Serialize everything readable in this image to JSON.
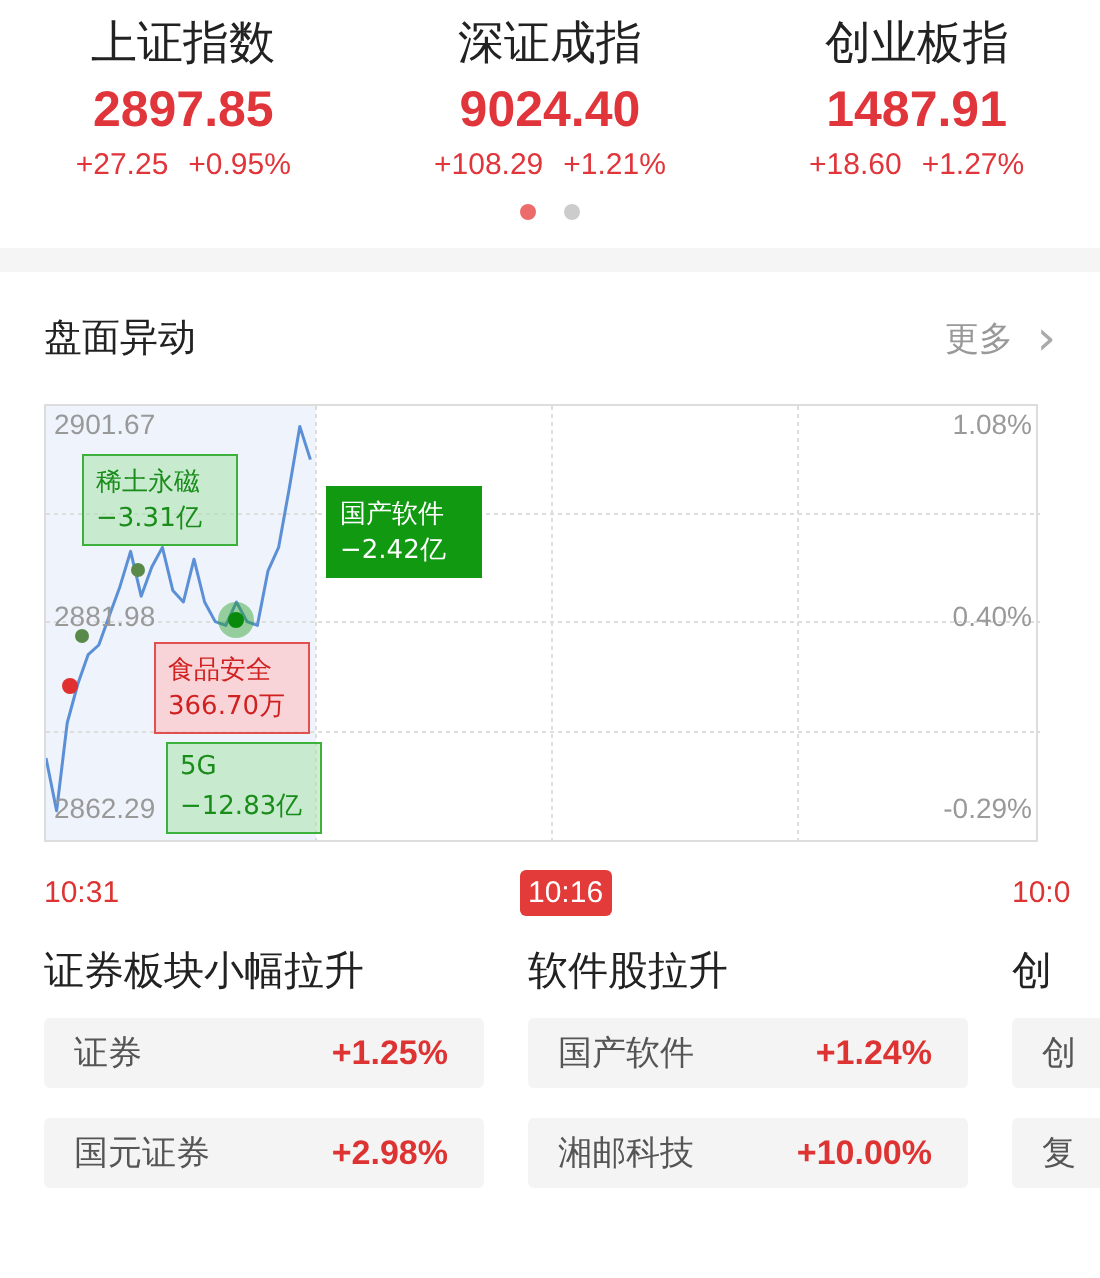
{
  "indices": [
    {
      "name": "上证指数",
      "value": "2897.85",
      "change": "+27.25",
      "percent": "+0.95%"
    },
    {
      "name": "深证成指",
      "value": "9024.40",
      "change": "+108.29",
      "percent": "+1.21%"
    },
    {
      "name": "创业板指",
      "value": "1487.91",
      "change": "+18.60",
      "percent": "+1.27%"
    }
  ],
  "pager": [
    {
      "selected": true
    },
    {
      "selected": false
    }
  ],
  "section": {
    "title": "盘面异动",
    "more": "更多",
    "more_arrow": "›"
  },
  "chart": {
    "chart_data": {
      "type": "line",
      "categories": [
        null,
        null,
        null,
        null,
        null,
        null,
        null,
        null,
        null,
        null,
        null,
        null,
        null,
        null,
        null,
        null,
        null,
        null,
        null,
        null,
        null,
        null,
        null,
        null,
        null,
        null,
        null,
        null,
        null,
        null,
        null,
        null,
        null,
        null,
        null,
        null,
        null,
        null,
        null,
        null,
        null,
        null,
        null,
        null,
        null,
        null,
        null,
        null,
        null,
        null,
        null,
        null,
        null,
        null,
        null,
        null,
        null,
        null,
        null,
        null,
        null,
        null,
        null,
        null,
        null,
        null,
        null,
        null,
        null,
        null,
        null,
        null,
        null,
        null,
        null,
        null,
        null,
        null,
        null,
        null,
        null,
        null,
        null,
        null,
        null,
        null,
        null,
        null,
        null,
        null,
        null,
        null,
        null,
        null,
        null
      ],
      "ylim": [
        2859.3,
        2903.8
      ],
      "yticks": [
        {
          "value": 2862.29,
          "label": "2862.29"
        },
        {
          "value": 2881.98,
          "label": "2881.98"
        },
        {
          "value": 2901.67,
          "label": "2901.67"
        }
      ],
      "series": [
        {
          "color": "#5b8fd6",
          "values": [
            2867.7,
            2862.3,
            2871.3,
            2875.3,
            2878.3,
            2879.3,
            2882.3,
            2885.3,
            2888.9,
            2884.3,
            2887.3,
            2889.3,
            2884.9,
            2883.7,
            2888.1,
            2883.7,
            2881.7,
            2881.3,
            2883.7,
            2881.7,
            2881.3,
            2886.9,
            2889.3,
            2895.3,
            2901.7,
            2898.3,
            null,
            null,
            null,
            null,
            null,
            null,
            null,
            null,
            null,
            null,
            null,
            null,
            null,
            null,
            null,
            null,
            null,
            null,
            null,
            null,
            null,
            null,
            null,
            null,
            null,
            null,
            null,
            null,
            null,
            null,
            null,
            null,
            null,
            null,
            null,
            null,
            null,
            null,
            null,
            null,
            null,
            null,
            null,
            null,
            null,
            null,
            null,
            null,
            null,
            null,
            null,
            null,
            null,
            null,
            null,
            null,
            null,
            null,
            null,
            null,
            null,
            null,
            null,
            null,
            null,
            null,
            null,
            null,
            null
          ]
        }
      ]
    },
    "pct_labels": [
      "1.08%",
      "0.40%",
      "-0.29%"
    ],
    "annotations": [
      {
        "kind": "outline-green",
        "name": "稀土永磁",
        "amount": "−3.31亿"
      },
      {
        "kind": "solid-green",
        "name": "国产软件",
        "amount": "−2.42亿"
      },
      {
        "kind": "outline-red",
        "name": "食品安全",
        "amount": "366.70万"
      },
      {
        "kind": "outline-green",
        "name": "5G",
        "amount": "−12.83亿"
      }
    ]
  },
  "events": [
    {
      "time": "10:31",
      "selected": false,
      "title": "证券板块小幅拉升",
      "rows": [
        {
          "name": "证券",
          "change": "+1.25%"
        },
        {
          "name": "国元证券",
          "change": "+2.98%"
        }
      ]
    },
    {
      "time": "10:16",
      "selected": true,
      "title": "软件股拉升",
      "rows": [
        {
          "name": "国产软件",
          "change": "+1.24%"
        },
        {
          "name": "湘邮科技",
          "change": "+10.00%"
        }
      ]
    },
    {
      "time": "10:0",
      "selected": false,
      "title": "创",
      "rows": [
        {
          "name": "创"
        },
        {
          "name": "复"
        }
      ]
    }
  ]
}
